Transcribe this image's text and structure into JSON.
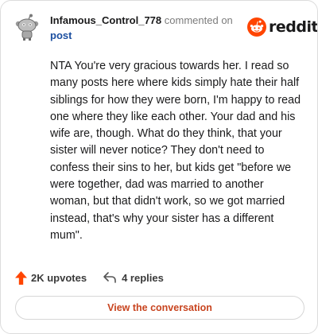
{
  "header": {
    "username": "Infamous_Control_778",
    "commented_text": "commented on",
    "post_link": "post"
  },
  "brand": {
    "logo_text": "reddit",
    "accent_color": "#ff4500"
  },
  "comment": {
    "body": "NTA You're very gracious towards her. I read so many posts here where kids simply hate their half siblings for how they were born, I'm happy to read one where they like each other. Your dad and his wife are, though. What do they think, that your sister will never notice? They don't need to confess their sins to her, but kids get \"before we were together, dad was married to another woman, but that didn't work, so we got married instead, that's why your sister has a different mum\"."
  },
  "actions": {
    "upvotes_label": "2K upvotes",
    "replies_label": "4 replies"
  },
  "cta": {
    "label": "View the conversation",
    "color": "#c8441f"
  },
  "icons": {
    "avatar": "snoo-avatar-icon",
    "logo": "reddit-snoo-logo-icon",
    "upvote": "upvote-arrow-icon",
    "reply": "reply-arrow-icon"
  }
}
